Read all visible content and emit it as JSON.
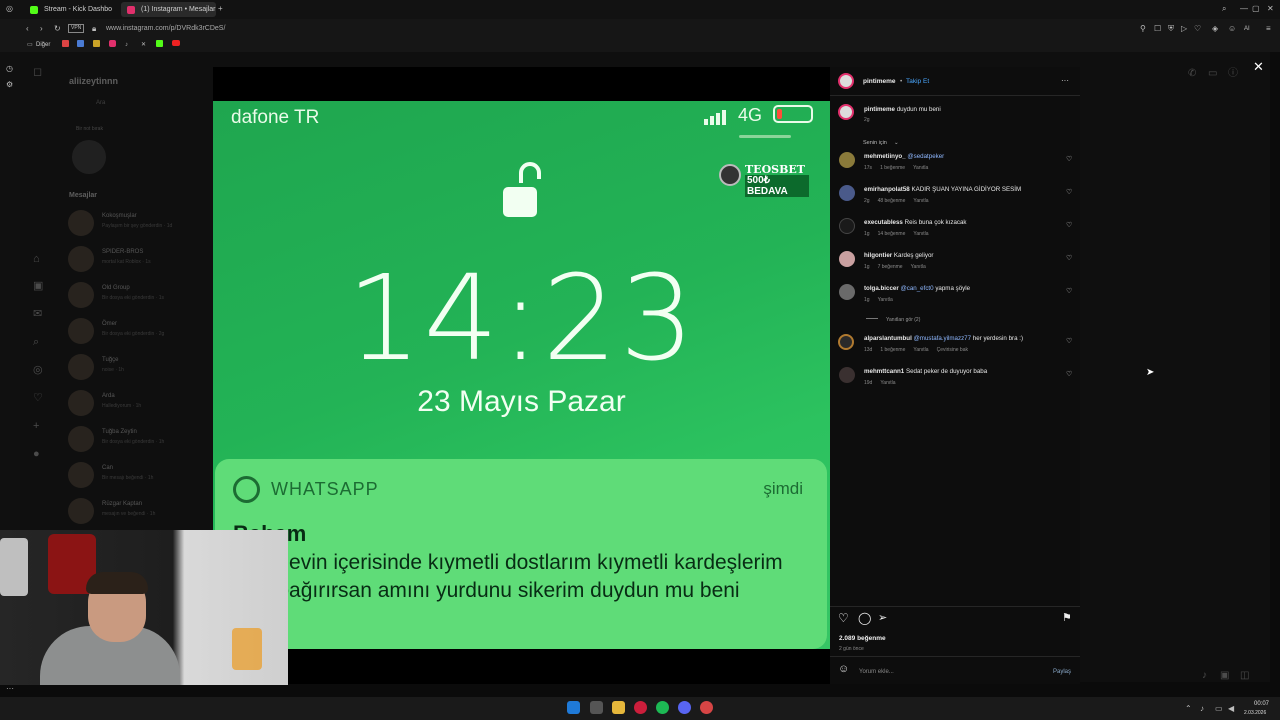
{
  "browser": {
    "tabs": [
      {
        "label": "Stream - Kick Dashbo"
      },
      {
        "label": "(1) Instagram • Mesajlar"
      }
    ],
    "url": "www.instagram.com/p/DVRdk3rCDeS/",
    "vpn": "VPN",
    "bookmarks": {
      "folder": "Diğer"
    }
  },
  "instagram_bg": {
    "username": "aliizeytinnn",
    "search_placeholder": "Ara",
    "note_label": "Bir not bırak",
    "section_messages": "Mesajlar",
    "dms": [
      {
        "name": "Kokoşmuşlar",
        "sub": "Paylaşım bir şey gönderdin · 1d"
      },
      {
        "name": "SPIDER-BROS",
        "sub": "mortal kat Roblox · 1s"
      },
      {
        "name": "Old Group",
        "sub": "Bir dosya eki gönderdin · 1s"
      },
      {
        "name": "Ömer",
        "sub": "Bir dosya eki gönderdin · 2g"
      },
      {
        "name": "Tuğçe",
        "sub": "noise · 1h"
      },
      {
        "name": "Arda",
        "sub": "Hallediyorum · 1h"
      },
      {
        "name": "Tuğba Zeytin",
        "sub": "Bir dosya eki gönderdin · 1h"
      },
      {
        "name": "Can",
        "sub": "Bir mesajı beğendi · 1h"
      },
      {
        "name": "Rüzgar Kaptan",
        "sub": "mesajın ve beğendi · 1h"
      }
    ]
  },
  "media": {
    "carrier": "dafone TR",
    "network": "4G",
    "time": "14:23",
    "date": "23 Mayıs Pazar",
    "sponsor_name": "TEOSBET",
    "sponsor_tag": "500₺ BEDAVA",
    "notification": {
      "app": "WHATSAPP",
      "when": "şimdi",
      "sender": "Babam",
      "body": "Daha evin içerisinde kıymetli dostlarım kıymetli kardeşlerim diye bağırırsan amını yurdunu sikerim duydun mu beni"
    }
  },
  "post": {
    "author": "pintimeme",
    "follow": "Takip Et",
    "caption": "duydun mu beni",
    "caption_age": "2g",
    "sort_label": "Senin için",
    "comments": [
      {
        "user": "mehmetiinyo_",
        "mention": "@sedatpeker",
        "text": "",
        "age": "17s",
        "likes": "1 beğenme",
        "reply": "Yanıtla"
      },
      {
        "user": "emirhanpolat58",
        "mention": "",
        "text": "KADIR ŞUAN YAYINA GİDİYOR SESİM",
        "age": "2g",
        "likes": "48 beğenme",
        "reply": "Yanıtla"
      },
      {
        "user": "executabless",
        "mention": "",
        "text": "Reis buna çok kızacak",
        "age": "1g",
        "likes": "14 beğenme",
        "reply": "Yanıtla"
      },
      {
        "user": "hilgontier",
        "mention": "",
        "text": "Kardeş geliyor",
        "age": "1g",
        "likes": "7 beğenme",
        "reply": "Yanıtla"
      },
      {
        "user": "tolga.biccer",
        "mention": "@can_efct0",
        "text": "yapma şöyle",
        "age": "1g",
        "likes": "",
        "reply": "Yanıtla"
      },
      {
        "user": "alparslantumbul",
        "mention": "@mustafa.yilmazz77",
        "text": "her yerdesin bra :)",
        "age": "13d",
        "likes": "1 beğenme",
        "reply": "Yanıtla",
        "translate": "Çevirisine bak"
      },
      {
        "user": "mehmttcann1",
        "mention": "",
        "text": "Sedat peker de duyuyor baba",
        "age": "19d",
        "likes": "",
        "reply": "Yanıtla"
      }
    ],
    "view_replies": "Yanıtları gör (2)",
    "likes_count": "2.089 beğenme",
    "posted": "2 gün önce",
    "comment_placeholder": "Yorum ekle...",
    "share_label": "Paylaş"
  },
  "taskbar": {
    "clock_time": "00:07",
    "clock_date": "2.03.2026"
  }
}
